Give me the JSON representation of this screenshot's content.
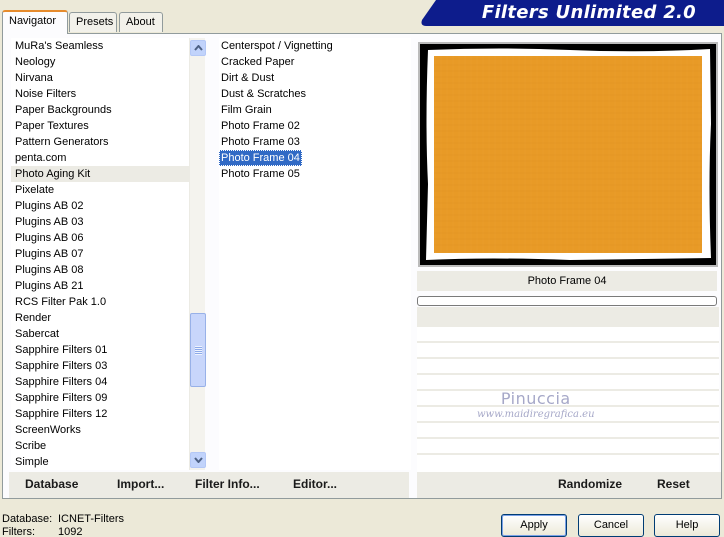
{
  "tabs": [
    {
      "label": "Navigator",
      "active": true
    },
    {
      "label": "Presets",
      "active": false
    },
    {
      "label": "About",
      "active": false
    }
  ],
  "brand": {
    "title": "Filters Unlimited 2.0",
    "color": "#0d1c8c"
  },
  "categories": {
    "items": [
      "MuRa's Seamless",
      "Neology",
      "Nirvana",
      "Noise Filters",
      "Paper Backgrounds",
      "Paper Textures",
      "Pattern Generators",
      "penta.com",
      "Photo Aging Kit",
      "Pixelate",
      "Plugins AB 02",
      "Plugins AB 03",
      "Plugins AB 06",
      "Plugins AB 07",
      "Plugins AB 08",
      "Plugins AB 21",
      "RCS Filter Pak 1.0",
      "Render",
      "Sabercat",
      "Sapphire Filters 01",
      "Sapphire Filters 03",
      "Sapphire Filters 04",
      "Sapphire Filters 09",
      "Sapphire Filters 12",
      "ScreenWorks",
      "Scribe",
      "Simple"
    ],
    "highlighted": "Photo Aging Kit"
  },
  "filters": {
    "items": [
      "Centerspot / Vignetting",
      "Cracked Paper",
      "Dirt & Dust",
      "Dust & Scratches",
      "Film Grain",
      "Photo Frame 02",
      "Photo Frame 03",
      "Photo Frame 04",
      "Photo Frame 05"
    ],
    "selected": "Photo Frame 04"
  },
  "scrollbar": {
    "up_icon": "arrow-up-icon",
    "down_icon": "arrow-down-icon",
    "position": 0.72
  },
  "preview": {
    "label": "Photo Frame 04",
    "fill_color": "#e89a26",
    "frame_color": "#000000",
    "progress": 0
  },
  "watermark": {
    "name": "Pinuccia",
    "url": "www.maidiregrafica.eu"
  },
  "toolbar": {
    "database": "Database",
    "import": "Import...",
    "filter_info": "Filter Info...",
    "editor": "Editor...",
    "randomize": "Randomize",
    "reset": "Reset"
  },
  "footer": {
    "database_key": "Database:",
    "database_value": "ICNET-Filters",
    "filters_key": "Filters:",
    "filters_value": "1092"
  },
  "buttons": {
    "apply": "Apply",
    "cancel": "Cancel",
    "help": "Help"
  }
}
